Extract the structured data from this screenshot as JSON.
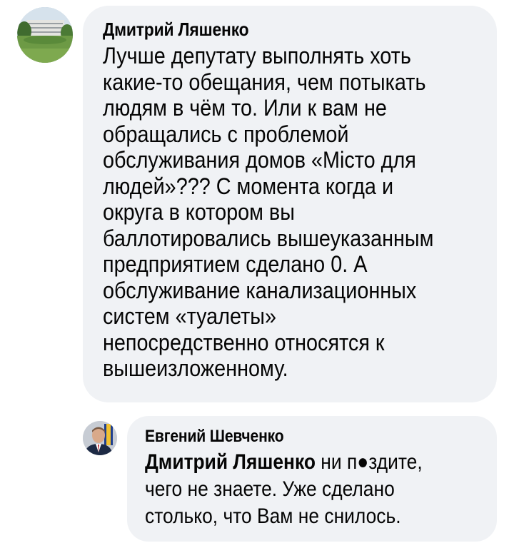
{
  "comments": [
    {
      "author": "Дмитрий Ляшенко",
      "avatar_icon": "profile-photo-building",
      "text": "Лучше депутату выполнять хоть\nкакие-то обещания, чем потыкать\nлюдям в чём то. Или к вам не\nобращались с проблемой\nобслуживания домов «Місто для\nлюдей»??? С момента когда и\nокруга в котором вы\nбаллотировались вышеуказанным\nпредприятием сделано 0. А\nобслуживание канализационных\nсистем «туалеты»\nнепосредственно относятся к\nвышеизложенному."
    },
    {
      "author": "Евгений Шевченко",
      "avatar_icon": "profile-photo-man-suit",
      "mention": "Дмитрий Ляшенко",
      "text": " ни п●здите,\nчего не знаете. Уже сделано\nстолько, что Вам не снилось."
    }
  ],
  "colors": {
    "bubble_bg": "#f0f2f5",
    "text": "#050505"
  }
}
